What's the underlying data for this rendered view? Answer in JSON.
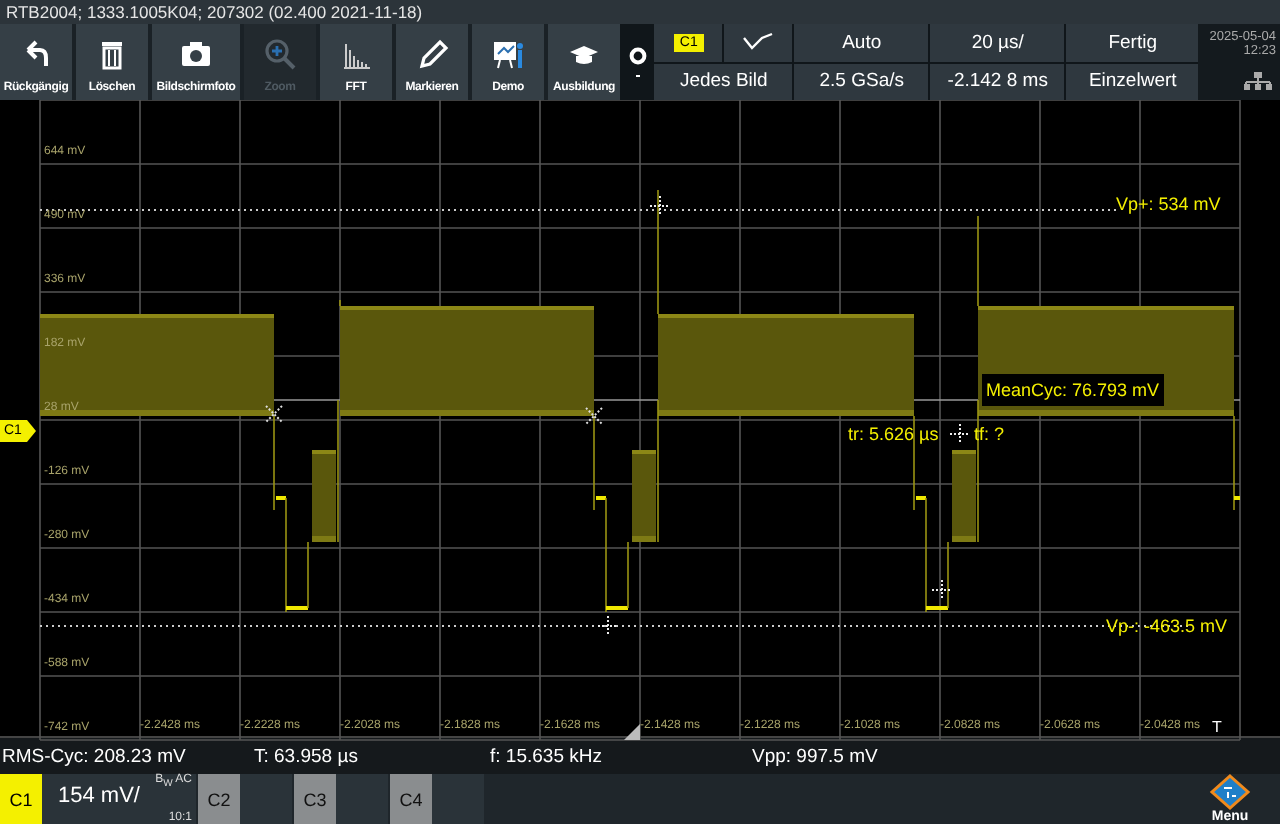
{
  "window": {
    "title": "RTB2004; 1333.1005K04; 207302 (02.400 2021-11-18)"
  },
  "toolbar": {
    "buttons": [
      {
        "label": "Rückgängig",
        "kind": "undo",
        "disabled": false
      },
      {
        "label": "Löschen",
        "kind": "trash",
        "disabled": false
      },
      {
        "label": "Bildschirmfoto",
        "kind": "camera",
        "disabled": false
      },
      {
        "label": "Zoom",
        "kind": "zoom",
        "disabled": true
      },
      {
        "label": "FFT",
        "kind": "fft",
        "disabled": false
      },
      {
        "label": "Markieren",
        "kind": "pencil",
        "disabled": false
      },
      {
        "label": "Demo",
        "kind": "presentation",
        "disabled": false
      },
      {
        "label": "Ausbildung",
        "kind": "cap",
        "disabled": false
      }
    ]
  },
  "trigger_panel": {
    "source": "C1",
    "mode": "Jedes Bild",
    "settings": [
      {
        "top": "Auto",
        "bottom": "2.5 GSa/s"
      },
      {
        "top": "20 µs/",
        "bottom": "-2.142 8 ms"
      },
      {
        "top": "Fertig",
        "bottom": "Einzelwert"
      }
    ]
  },
  "clock": {
    "date": "2025-05-04",
    "time": "12:23"
  },
  "plot": {
    "level_marker": "C1",
    "trigger_marker": "T",
    "y_labels": [
      "644 mV",
      "490 mV",
      "336 mV",
      "182 mV",
      "28 mV",
      "-126 mV",
      "-280 mV",
      "-434 mV",
      "-588 mV",
      "-742 mV"
    ],
    "x_labels": [
      "-2.2428 ms",
      "-2.2228 ms",
      "-2.2028 ms",
      "-2.1828 ms",
      "-2.1628 ms",
      "-2.1428 ms",
      "-2.1228 ms",
      "-2.1028 ms",
      "-2.0828 ms",
      "-2.0628 ms",
      "-2.0428 ms"
    ],
    "annotations": [
      {
        "kind": "vp_plus",
        "text": "Vp+: 534 mV"
      },
      {
        "kind": "mean",
        "text": "MeanCyc: 76.793 mV"
      },
      {
        "kind": "tr",
        "text": "tr: 5.626 µs"
      },
      {
        "kind": "tf",
        "text": "tf: ?"
      },
      {
        "kind": "vp_minus",
        "text": "Vp-: -463.5 mV"
      }
    ]
  },
  "measurements": [
    "RMS-Cyc: 208.23 mV",
    "T: 63.958 µs",
    "f: 15.635 kHz",
    "Vpp: 997.5 mV"
  ],
  "channels": [
    {
      "label": "C1",
      "selected": true,
      "scale": "154 mV/",
      "coupling": "B$_{W}$ AC",
      "probe": "10:1"
    },
    {
      "label": "C2",
      "selected": false
    },
    {
      "label": "C3",
      "selected": false
    },
    {
      "label": "C4",
      "selected": false
    }
  ],
  "menu": {
    "label": "Menu"
  }
}
